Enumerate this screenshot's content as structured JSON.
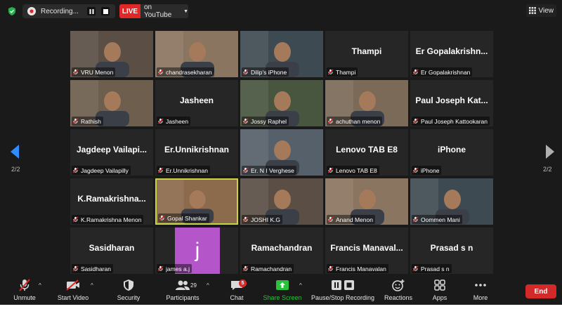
{
  "topbar": {
    "recording_label": "Recording...",
    "live_label": "LIVE",
    "stream_label": "on YouTube",
    "view_label": "View"
  },
  "pager": {
    "left_label": "2/2",
    "right_label": "2/2"
  },
  "participants": [
    {
      "name": "VRU Menon",
      "display": "",
      "video": "photo"
    },
    {
      "name": "chandrasekharan",
      "display": "",
      "video": "photo"
    },
    {
      "name": "Dilip's iPhone",
      "display": "",
      "video": "photo"
    },
    {
      "name": "Thampi",
      "display": "Thampi",
      "video": "name"
    },
    {
      "name": "Er Gopalakrishnan",
      "display": "Er Gopalakrishn...",
      "video": "name"
    },
    {
      "name": "Rathish",
      "display": "",
      "video": "photo"
    },
    {
      "name": "Jasheen",
      "display": "Jasheen",
      "video": "name"
    },
    {
      "name": "Jossy Raphel",
      "display": "",
      "video": "photo"
    },
    {
      "name": "achuthan menon",
      "display": "",
      "video": "photo"
    },
    {
      "name": "Paul Joseph Kattookaran",
      "display": "Paul Joseph Kat...",
      "video": "name"
    },
    {
      "name": "Jagdeep Vailapilly",
      "display": "Jagdeep Vailapi...",
      "video": "name"
    },
    {
      "name": "Er.Unnikrishnan",
      "display": "Er.Unnikrishnan",
      "video": "name"
    },
    {
      "name": "Er. N I Verghese",
      "display": "",
      "video": "photo"
    },
    {
      "name": "Lenovo TAB E8",
      "display": "Lenovo TAB E8",
      "video": "name"
    },
    {
      "name": "iPhone",
      "display": "iPhone",
      "video": "name"
    },
    {
      "name": "K.Ramakrishna Menon",
      "display": "K.Ramakrishna...",
      "video": "name"
    },
    {
      "name": "Gopal Shankar",
      "display": "",
      "video": "photo"
    },
    {
      "name": "JOSHI K.G",
      "display": "",
      "video": "photo"
    },
    {
      "name": "Anand Menon",
      "display": "",
      "video": "photo"
    },
    {
      "name": "Oommen Mani",
      "display": "",
      "video": "photo"
    },
    {
      "name": "Sasidharan",
      "display": "Sasidharan",
      "video": "name"
    },
    {
      "name": "james a.j",
      "display": "j",
      "video": "avatar"
    },
    {
      "name": "Ramachandran",
      "display": "Ramachandran",
      "video": "name"
    },
    {
      "name": "Francis Manavalan",
      "display": "Francis Manaval...",
      "video": "name"
    },
    {
      "name": "Prasad s n",
      "display": "Prasad s n",
      "video": "name"
    }
  ],
  "toolbar": {
    "unmute": "Unmute",
    "start_video": "Start Video",
    "security": "Security",
    "participants": "Participants",
    "participants_count": "29",
    "chat": "Chat",
    "chat_badge": "5",
    "share_screen": "Share Screen",
    "pause_stop_recording": "Pause/Stop Recording",
    "reactions": "Reactions",
    "apps": "Apps",
    "more": "More",
    "end": "End"
  },
  "colors": {
    "background": "#1a1a1a",
    "tile": "#262626",
    "live_red": "#e02828",
    "share_green": "#29c23b",
    "active_speaker": "#c7d445",
    "end_red": "#d32929",
    "avatar_purple": "#b455c9"
  },
  "icons": [
    "shield-icon",
    "cloud-record-icon",
    "pause-icon",
    "stop-icon",
    "grid-view-icon",
    "muted-mic-icon",
    "video-off-icon",
    "security-icon",
    "participants-icon",
    "chat-icon",
    "share-screen-icon",
    "pause-stop-recording-icon",
    "reactions-icon",
    "apps-icon",
    "more-icon",
    "chevron-left-icon",
    "chevron-right-icon"
  ]
}
